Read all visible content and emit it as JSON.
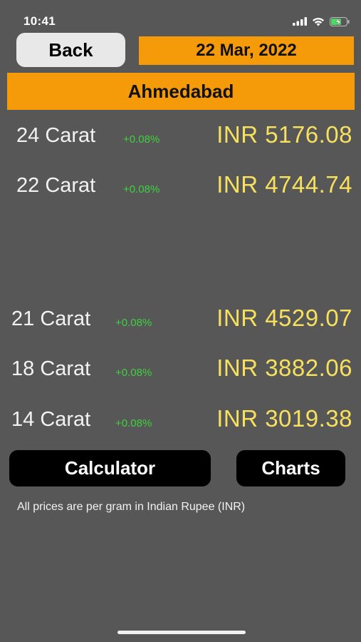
{
  "status": {
    "time": "10:41",
    "icons": [
      "cellular-signal-icon",
      "wifi-icon",
      "battery-charging-icon"
    ]
  },
  "header": {
    "back_label": "Back",
    "date": "22 Mar, 2022",
    "city": "Ahmedabad"
  },
  "rates": [
    {
      "carat": "24 Carat",
      "change": "+0.08%",
      "price": "INR 5176.08"
    },
    {
      "carat": "22 Carat",
      "change": "+0.08%",
      "price": "INR 4744.74"
    },
    {
      "carat": "21 Carat",
      "change": "+0.08%",
      "price": "INR 4529.07"
    },
    {
      "carat": "18 Carat",
      "change": "+0.08%",
      "price": "INR 3882.06"
    },
    {
      "carat": "14 Carat",
      "change": "+0.08%",
      "price": "INR 3019.38"
    }
  ],
  "actions": {
    "calculator_label": "Calculator",
    "charts_label": "Charts"
  },
  "footnote": "All prices are per gram in Indian Rupee (INR)",
  "colors": {
    "background": "#575757",
    "accent": "#f59b0a",
    "price": "#f6e05e",
    "change_positive": "#3fd13f"
  }
}
